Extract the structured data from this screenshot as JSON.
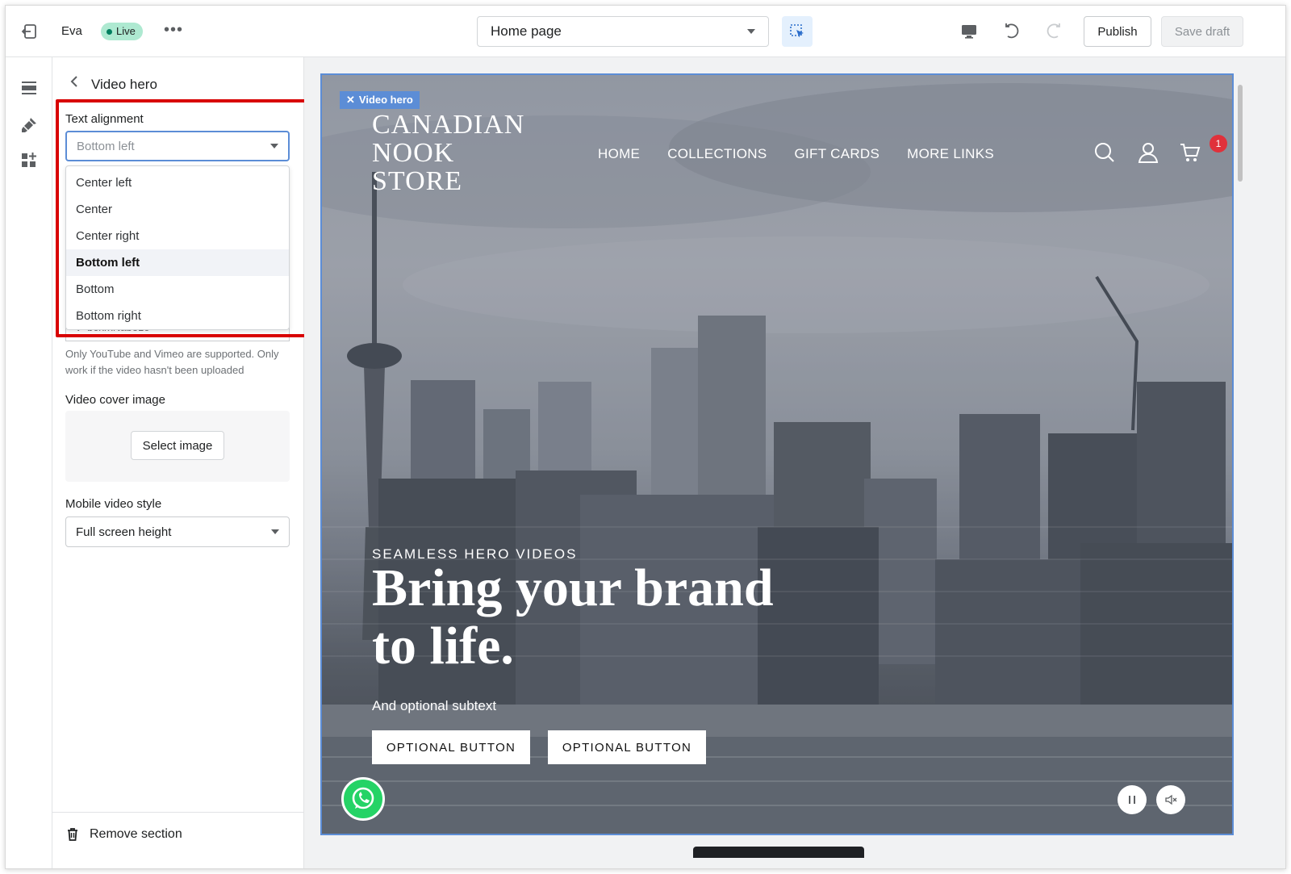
{
  "topbar": {
    "theme_name": "Eva",
    "status_badge": "Live",
    "more": "•••",
    "page_select": "Home page",
    "publish_label": "Publish",
    "save_draft_label": "Save draft"
  },
  "panel": {
    "title": "Video hero",
    "text_alignment_label": "Text alignment",
    "text_alignment_value": "Bottom left",
    "alignment_options": [
      "Center left",
      "Center",
      "Center right",
      "Bottom left",
      "Bottom",
      "Bottom right"
    ],
    "selected_option_index": 3,
    "hidden_url_fragment": "v=b0xrxNabe1o",
    "help_text": "Only YouTube and Vimeo are supported. Only work if the video hasn't been uploaded",
    "cover_image_label": "Video cover image",
    "select_image_label": "Select image",
    "mobile_style_label": "Mobile video style",
    "mobile_style_value": "Full screen height",
    "remove_section_label": "Remove section"
  },
  "preview": {
    "section_tag": "Video hero",
    "logo_lines": [
      "CANADIAN",
      "NOOK",
      "STORE"
    ],
    "nav": [
      "HOME",
      "COLLECTIONS",
      "GIFT CARDS",
      "MORE LINKS"
    ],
    "cart_count": "1",
    "kicker": "SEAMLESS HERO VIDEOS",
    "headline": "Bring your brand to life.",
    "subtext": "And optional subtext",
    "button_1": "OPTIONAL BUTTON",
    "button_2": "OPTIONAL BUTTON"
  },
  "colors": {
    "accent_blue": "#5c8dd6",
    "highlight_red": "#d80000",
    "live_green": "#aee9d1",
    "whatsapp_green": "#25d366",
    "cart_badge_red": "#e0313b"
  },
  "icons": [
    "exit-icon",
    "more-icon",
    "inspector-icon",
    "desktop-icon",
    "undo-icon",
    "redo-icon",
    "sections-icon",
    "theme-settings-icon",
    "apps-icon",
    "back-chevron-icon",
    "trash-icon",
    "search-icon",
    "account-icon",
    "cart-icon",
    "whatsapp-icon",
    "pause-icon",
    "mute-icon"
  ]
}
